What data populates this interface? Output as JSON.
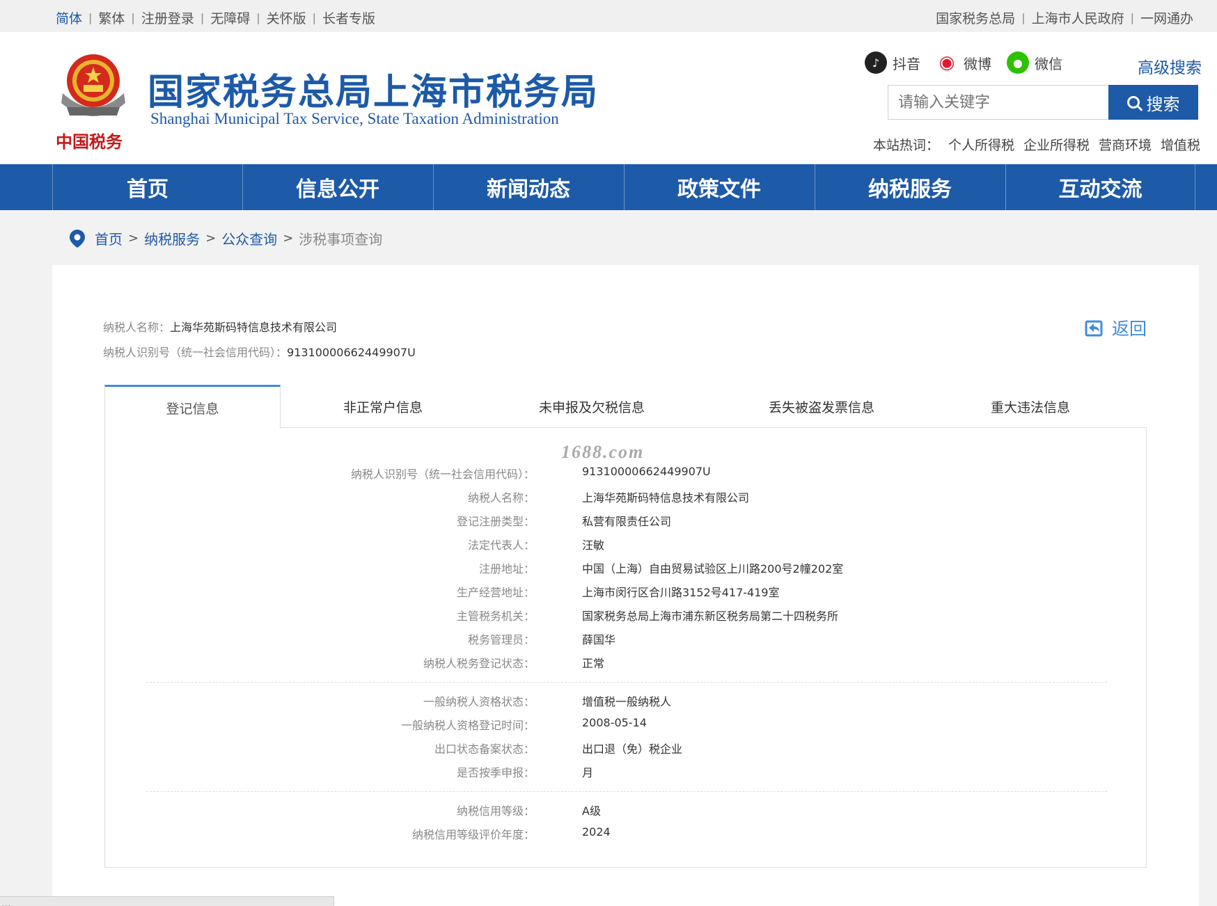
{
  "topbar": {
    "left_links": [
      "简体",
      "繁体",
      "注册登录",
      "无障碍",
      "关怀版",
      "长者专版"
    ],
    "right_links": [
      "国家税务总局",
      "上海市人民政府",
      "一网通办"
    ]
  },
  "header": {
    "emblem_caption": "中国税务",
    "title_cn": "国家税务总局上海市税务局",
    "title_en": "Shanghai Municipal Tax Service, State Taxation Administration",
    "social": [
      {
        "label": "抖音",
        "icon": "tiktok-icon"
      },
      {
        "label": "微博",
        "icon": "weibo-icon"
      },
      {
        "label": "微信",
        "icon": "wechat-icon"
      }
    ],
    "advanced_search": "高级搜索",
    "search_placeholder": "请输入关键字",
    "search_button": "搜索",
    "hotwords_label": "本站热词：",
    "hotwords": [
      "个人所得税",
      "企业所得税",
      "营商环境",
      "增值税"
    ]
  },
  "nav": [
    "首页",
    "信息公开",
    "新闻动态",
    "政策文件",
    "纳税服务",
    "互动交流"
  ],
  "breadcrumb": {
    "items": [
      "首页",
      "纳税服务",
      "公众查询"
    ],
    "separator": ">",
    "current": "涉税事项查询"
  },
  "taxpayer": {
    "name_label": "纳税人名称：",
    "name": "上海华苑斯码特信息技术有限公司",
    "id_label": "纳税人识别号（统一社会信用代码）：",
    "id": "91310000662449907U"
  },
  "back_label": "返回",
  "tabs": [
    {
      "label": "登记信息",
      "active": true
    },
    {
      "label": "非正常户信息",
      "active": false
    },
    {
      "label": "未申报及欠税信息",
      "active": false
    },
    {
      "label": "丢失被盗发票信息",
      "active": false
    },
    {
      "label": "重大违法信息",
      "active": false
    }
  ],
  "watermark": "1688.com",
  "registration": {
    "group1": [
      {
        "label": "纳税人识别号（统一社会信用代码）：",
        "value": "91310000662449907U"
      },
      {
        "label": "纳税人名称：",
        "value": "上海华苑斯码特信息技术有限公司"
      },
      {
        "label": "登记注册类型：",
        "value": "私营有限责任公司"
      },
      {
        "label": "法定代表人：",
        "value": "汪敏"
      },
      {
        "label": "注册地址：",
        "value": "中国（上海）自由贸易试验区上川路200号2幢202室"
      },
      {
        "label": "生产经营地址：",
        "value": "上海市闵行区合川路3152号417-419室"
      },
      {
        "label": "主管税务机关：",
        "value": "国家税务总局上海市浦东新区税务局第二十四税务所"
      },
      {
        "label": "税务管理员：",
        "value": "薛国华"
      },
      {
        "label": "纳税人税务登记状态：",
        "value": "正常"
      }
    ],
    "group2": [
      {
        "label": "一般纳税人资格状态：",
        "value": "增值税一般纳税人"
      },
      {
        "label": "一般纳税人资格登记时间：",
        "value": "2008-05-14"
      },
      {
        "label": "出口状态备案状态：",
        "value": "出口退（免）税企业"
      },
      {
        "label": "是否按季申报：",
        "value": "月"
      }
    ],
    "group3": [
      {
        "label": "纳税信用等级：",
        "value": "A级"
      },
      {
        "label": "纳税信用等级评价年度：",
        "value": "2024"
      }
    ]
  },
  "statusbar_text": "...",
  "colors": {
    "brand_blue": "#1d5aa8",
    "link_blue": "#3f8be0",
    "page_bg": "#f2f2f2"
  }
}
